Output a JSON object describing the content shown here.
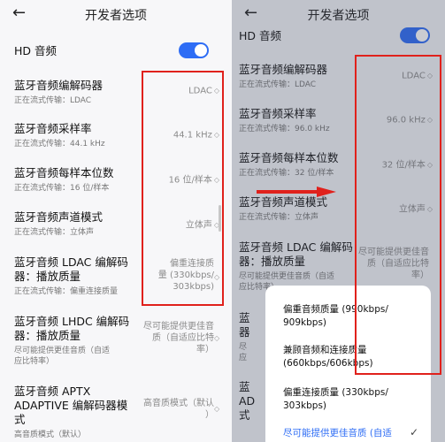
{
  "header": {
    "back_icon": "arrow-left-icon",
    "title": "开发者选项"
  },
  "left": {
    "hd_audio": "HD 音频",
    "codec": {
      "title": "蓝牙音频编解码器",
      "sub": "正在流式传输：LDAC",
      "value": "LDAC"
    },
    "sample_rate": {
      "title": "蓝牙音频采样率",
      "sub": "正在流式传输：44.1 kHz",
      "value": "44.1 kHz"
    },
    "bits": {
      "title": "蓝牙音频每样本位数",
      "sub": "正在流式传输：16 位/样本",
      "value": "16 位/样本"
    },
    "channel": {
      "title": "蓝牙音频声道模式",
      "sub": "正在流式传输：立体声",
      "value": "立体声"
    },
    "ldac": {
      "title_l1": "蓝牙音频 LDAC 编解码",
      "title_l2": "器：播放质量",
      "sub": "正在流式传输：偏重连接质量",
      "value_l1": "偏重连接质",
      "value_l2": "量 (330kbps/",
      "value_l3": "303kbps)"
    },
    "lhdc": {
      "title_l1": "蓝牙音频 LHDC 编解码",
      "title_l2": "器：播放质量",
      "sub_l1": "尽可能提供更佳音质（自适",
      "sub_l2": "应比特率）",
      "value_l1": "尽可能提供更佳音",
      "value_l2": "质（自适应比特",
      "value_l3": "率）"
    },
    "aptx": {
      "title_l1": "蓝牙音频 APTX",
      "title_l2": "ADAPTIVE 编解码器模",
      "title_l3": "式",
      "sub": "高音质模式（默认）",
      "value_l1": "高音质模式（默认",
      "value_l2": "）"
    }
  },
  "right": {
    "hd_audio": "HD 音频",
    "codec": {
      "title": "蓝牙音频编解码器",
      "sub": "正在流式传输：LDAC",
      "value": "LDAC"
    },
    "sample_rate": {
      "title": "蓝牙音频采样率",
      "sub": "正在流式传输：96.0 kHz",
      "value": "96.0 kHz"
    },
    "bits": {
      "title": "蓝牙音频每样本位数",
      "sub": "正在流式传输：32 位/样本",
      "value": "32 位/样本"
    },
    "channel": {
      "title": "蓝牙音频声道模式",
      "sub": "正在流式传输：立体声",
      "value": "立体声"
    },
    "ldac": {
      "title_l1": "蓝牙音频 LDAC 编解码",
      "title_l2": "器：播放质量",
      "sub_l1": "尽可能提供更佳音质（自适",
      "sub_l2": "应比特率）",
      "value_l1": "尽可能提供更佳音",
      "value_l2": "质（自适应比特",
      "value_l3": "率）"
    },
    "lhdc_fragment": {
      "t1": "蓝",
      "t2": "器",
      "s1": "尽",
      "s2": "应"
    },
    "aptx_fragment": {
      "t1": "蓝",
      "t2": "AD",
      "t3": "式"
    },
    "sheet": {
      "opt1_l1": "偏重音频质量 (990kbps/",
      "opt1_l2": "909kbps)",
      "opt2_l1": "兼顾音频和连接质量",
      "opt2_l2": "(660kbps/606kbps)",
      "opt3_l1": "偏重连接质量 (330kbps/",
      "opt3_l2": "303kbps)",
      "opt4_l1": "尽可能提供更佳音质 (自适"
    }
  },
  "colors": {
    "accent": "#2e6df5",
    "highlight": "#e0211c"
  }
}
